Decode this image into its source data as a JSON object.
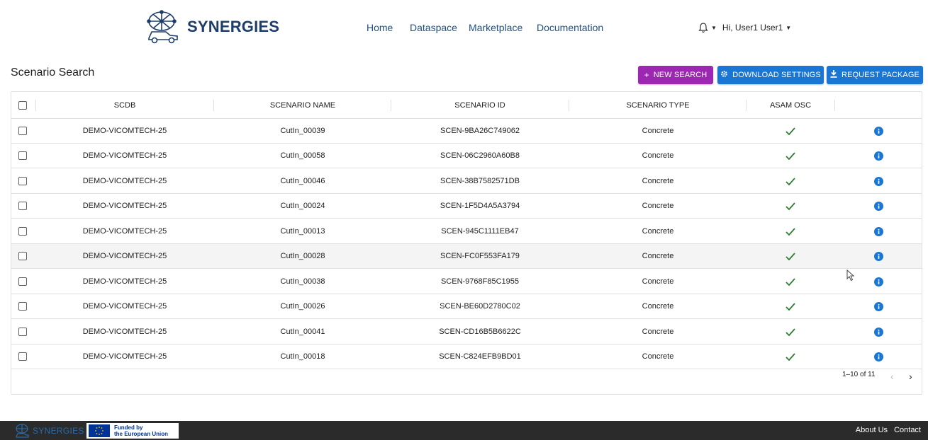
{
  "header": {
    "brand": "SYNERGIES",
    "nav": [
      {
        "label": "Home"
      },
      {
        "label": "Dataspace"
      },
      {
        "label": "Marketplace"
      },
      {
        "label": "Documentation"
      }
    ],
    "greeting": "Hi, User1 User1"
  },
  "page": {
    "title": "Scenario Search"
  },
  "toolbar": {
    "new_search": "NEW SEARCH",
    "download_settings": "DOWNLOAD SETTINGS",
    "request_package": "REQUEST PACKAGE",
    "new_search_color": "#9c27b0",
    "primary_color": "#1976d2"
  },
  "table": {
    "columns": [
      "SCDB",
      "SCENARIO NAME",
      "SCENARIO ID",
      "SCENARIO TYPE",
      "ASAM OSC"
    ],
    "rows": [
      {
        "scdb": "DEMO-VICOMTECH-25",
        "name": "CutIn_00039",
        "id": "SCEN-9BA26C749062",
        "type": "Concrete",
        "asam_osc": true
      },
      {
        "scdb": "DEMO-VICOMTECH-25",
        "name": "CutIn_00058",
        "id": "SCEN-06C2960A60B8",
        "type": "Concrete",
        "asam_osc": true
      },
      {
        "scdb": "DEMO-VICOMTECH-25",
        "name": "CutIn_00046",
        "id": "SCEN-38B7582571DB",
        "type": "Concrete",
        "asam_osc": true
      },
      {
        "scdb": "DEMO-VICOMTECH-25",
        "name": "CutIn_00024",
        "id": "SCEN-1F5D4A5A3794",
        "type": "Concrete",
        "asam_osc": true
      },
      {
        "scdb": "DEMO-VICOMTECH-25",
        "name": "CutIn_00013",
        "id": "SCEN-945C1111EB47",
        "type": "Concrete",
        "asam_osc": true
      },
      {
        "scdb": "DEMO-VICOMTECH-25",
        "name": "CutIn_00028",
        "id": "SCEN-FC0F553FA179",
        "type": "Concrete",
        "asam_osc": true
      },
      {
        "scdb": "DEMO-VICOMTECH-25",
        "name": "CutIn_00038",
        "id": "SCEN-9768F85C1955",
        "type": "Concrete",
        "asam_osc": true
      },
      {
        "scdb": "DEMO-VICOMTECH-25",
        "name": "CutIn_00026",
        "id": "SCEN-BE60D2780C02",
        "type": "Concrete",
        "asam_osc": true
      },
      {
        "scdb": "DEMO-VICOMTECH-25",
        "name": "CutIn_00041",
        "id": "SCEN-CD16B5B6622C",
        "type": "Concrete",
        "asam_osc": true
      },
      {
        "scdb": "DEMO-VICOMTECH-25",
        "name": "CutIn_00018",
        "id": "SCEN-C824EFB9BD01",
        "type": "Concrete",
        "asam_osc": true
      }
    ],
    "highlighted_row": 5,
    "pagination": "1–10 of 11",
    "check_color": "#2e7d32",
    "info_color": "#1976d2"
  },
  "footer": {
    "brand": "SYNERGIES",
    "eu_line1": "Funded by",
    "eu_line2": "the European Union",
    "links": [
      "About Us",
      "Contact"
    ]
  }
}
